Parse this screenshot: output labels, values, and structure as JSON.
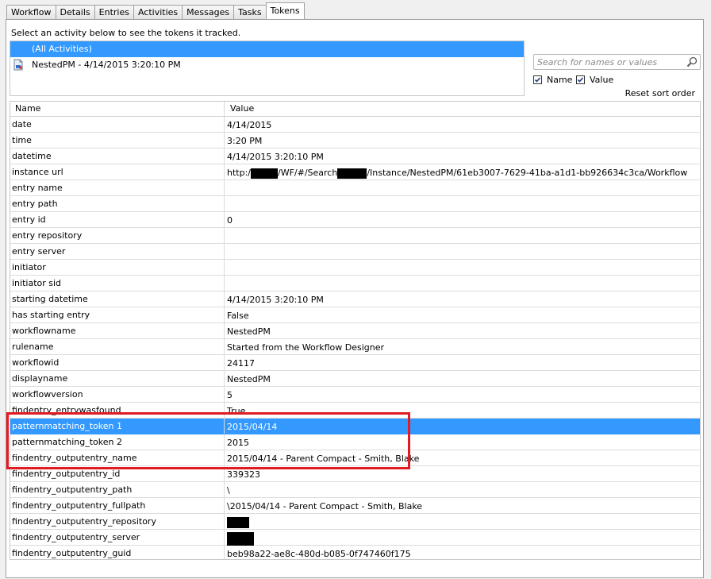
{
  "tabs": [
    {
      "label": "Workflow",
      "active": false
    },
    {
      "label": "Details",
      "active": false
    },
    {
      "label": "Entries",
      "active": false
    },
    {
      "label": "Activities",
      "active": false
    },
    {
      "label": "Messages",
      "active": false
    },
    {
      "label": "Tasks",
      "active": false
    },
    {
      "label": "Tokens",
      "active": true
    }
  ],
  "instruction": "Select an activity below to see the tokens it tracked.",
  "activities": [
    {
      "label": "(All Activities)",
      "selected": true,
      "icon": null
    },
    {
      "label": "NestedPM - 4/14/2015 3:20:10 PM",
      "selected": false,
      "icon": "workflow-document-icon"
    }
  ],
  "search": {
    "placeholder": "Search for names or values",
    "value": "",
    "icon": "search-icon"
  },
  "filters": {
    "name": {
      "label": "Name",
      "checked": true
    },
    "value": {
      "label": "Value",
      "checked": true
    }
  },
  "reset_label": "Reset sort order",
  "grid": {
    "headers": {
      "name": "Name",
      "value": "Value"
    },
    "rows": [
      {
        "name": "date",
        "value": "4/14/2015"
      },
      {
        "name": "time",
        "value": "3:20 PM"
      },
      {
        "name": "datetime",
        "value": "4/14/2015 3:20:10 PM"
      },
      {
        "name": "instance url",
        "value_parts": [
          "http:/",
          "",
          "/WF/#/Search",
          "",
          "/Instance/NestedPM/61eb3007-7629-41ba-a1d1-bb926634c3ca/Workflow"
        ]
      },
      {
        "name": "entry name",
        "value": ""
      },
      {
        "name": "entry path",
        "value": ""
      },
      {
        "name": "entry id",
        "value": "0"
      },
      {
        "name": "entry repository",
        "value": ""
      },
      {
        "name": "entry server",
        "value": ""
      },
      {
        "name": "initiator",
        "value": ""
      },
      {
        "name": "initiator sid",
        "value": ""
      },
      {
        "name": "starting datetime",
        "value": "4/14/2015 3:20:10 PM"
      },
      {
        "name": "has starting entry",
        "value": "False"
      },
      {
        "name": "workflowname",
        "value": "NestedPM"
      },
      {
        "name": "rulename",
        "value": "Started from the Workflow Designer"
      },
      {
        "name": "workflowid",
        "value": "24117"
      },
      {
        "name": "displayname",
        "value": "NestedPM"
      },
      {
        "name": "workflowversion",
        "value": "5"
      },
      {
        "name": "findentry_entrywasfound",
        "value": "True"
      },
      {
        "name": "patternmatching_token 1",
        "value": "2015/04/14",
        "selected": true
      },
      {
        "name": "patternmatching_token 2",
        "value": "2015"
      },
      {
        "name": "findentry_outputentry_name",
        "value": "2015/04/14 - Parent Compact - Smith, Blake"
      },
      {
        "name": "findentry_outputentry_id",
        "value": "339323"
      },
      {
        "name": "findentry_outputentry_path",
        "value": "\\"
      },
      {
        "name": "findentry_outputentry_fullpath",
        "value": "\\2015/04/14 - Parent Compact - Smith, Blake"
      },
      {
        "name": "findentry_outputentry_repository",
        "redacted": true
      },
      {
        "name": "findentry_outputentry_server",
        "redacted": true
      },
      {
        "name": "findentry_outputentry_guid",
        "value": "beb98a22-ae8c-480d-b085-0f747460f175"
      }
    ]
  },
  "colors": {
    "selection": "#3399ff",
    "highlight_border": "#e21b23",
    "redaction": "#000000"
  }
}
